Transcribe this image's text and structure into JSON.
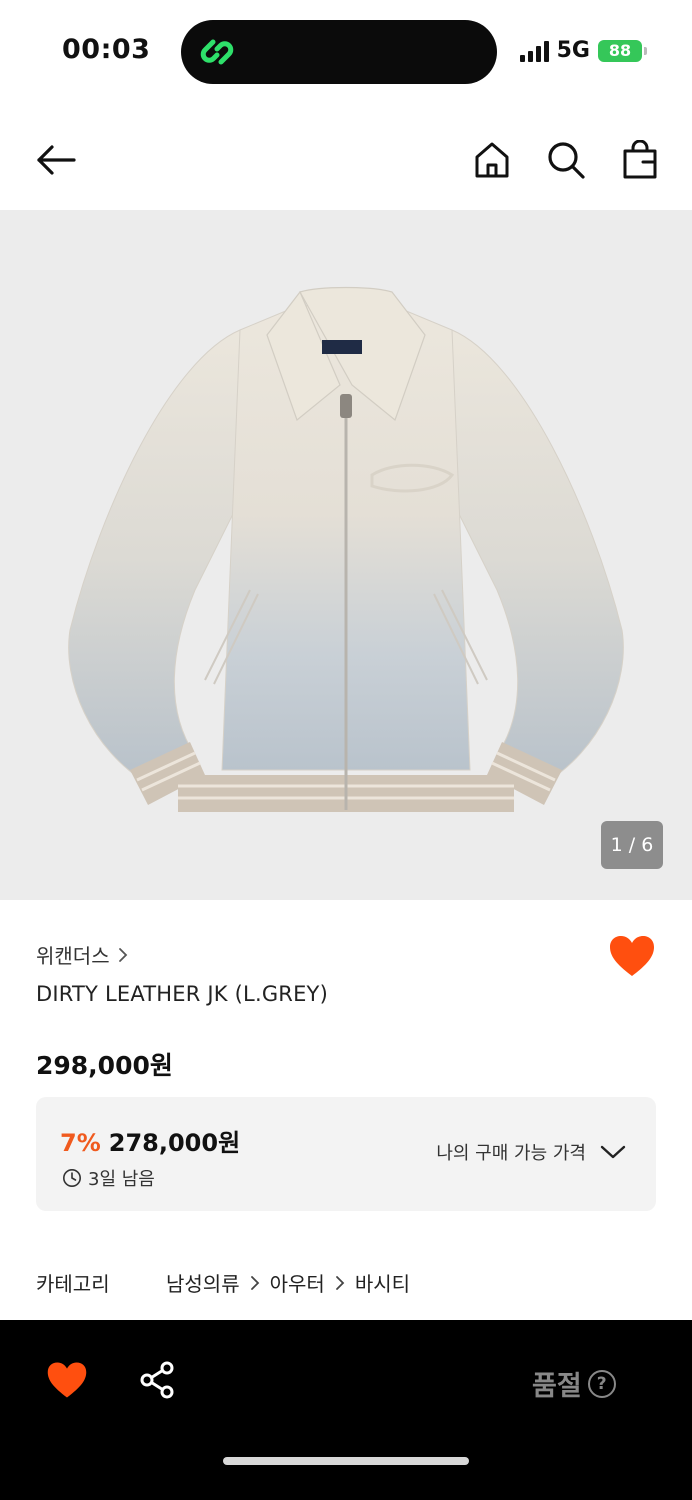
{
  "status_bar": {
    "time": "00:03",
    "network": "5G",
    "battery": "88"
  },
  "nav": {
    "back_icon": "arrow-left-icon",
    "home_icon": "home-icon",
    "search_icon": "search-icon",
    "bag_icon": "shopping-bag-icon"
  },
  "gallery": {
    "counter": "1 / 6",
    "image_subject": "cream-to-grey gradient leather varsity jacket"
  },
  "product": {
    "brand": "위캔더스",
    "name": "DIRTY LEATHER JK (L.GREY)",
    "price": "298,000원",
    "liked": true
  },
  "discount": {
    "rate": "7%",
    "price": "278,000원",
    "time_left": "3일 남음",
    "dropdown_label": "나의 구매 가능 가격"
  },
  "category": {
    "label": "카테고리",
    "path": [
      "남성의류",
      "아우터",
      "바시티"
    ]
  },
  "bottom_bar": {
    "sold_out_label": "품절",
    "help_glyph": "?"
  },
  "colors": {
    "accent": "#f05a1e",
    "heart": "#ff4f0f",
    "bottom_bar_bg": "#000000",
    "battery": "#35c759"
  }
}
